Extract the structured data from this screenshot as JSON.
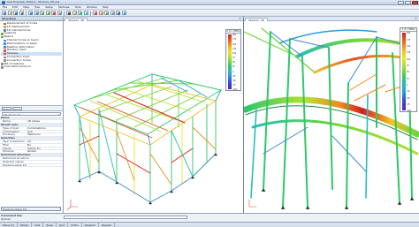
{
  "window": {
    "title": "Scia Engineer 2008.0 - Stadium_3D.esa"
  },
  "menu": [
    "File",
    "Edit",
    "View",
    "Tree",
    "Setup",
    "Modules",
    "Tools",
    "Window",
    "Help"
  ],
  "toolbar": {
    "button_icons": [
      "new-icon",
      "open-icon",
      "save-icon",
      "print-icon",
      "undo-icon",
      "redo-icon",
      "zoom-icon",
      "zoom-all-icon",
      "rotate-icon",
      "pan-icon",
      "select-icon",
      "section-icon",
      "render-icon",
      "wireframe-icon",
      "results-icon",
      "calc-icon",
      "check-icon",
      "settings-icon",
      "report-icon",
      "help-icon"
    ]
  },
  "left_panel": {
    "tree_title": "Structure",
    "tree_items": [
      {
        "label": "Displacement of nodes",
        "level": 1,
        "color": "#d04b3a"
      },
      {
        "label": "1D displacement",
        "level": 1,
        "color": "#e0a23a"
      },
      {
        "label": "1D internal forces",
        "level": 1,
        "color": "#3a8bd0"
      },
      {
        "label": "Supports",
        "level": 0,
        "color": "#6aa84f"
      },
      {
        "label": "Beams",
        "level": 0,
        "color": "#6aa84f"
      },
      {
        "label": "Internal forces on beam",
        "level": 1,
        "color": "#3a8bd0"
      },
      {
        "label": "Deformations on beam",
        "level": 1,
        "color": "#3a8bd0"
      },
      {
        "label": "Relative deformation",
        "level": 1,
        "color": "#3a8bd0"
      },
      {
        "label": "Member check",
        "level": 1,
        "color": "#d04b3a"
      },
      {
        "label": "Stresses",
        "level": 1,
        "color": "#d04b3a",
        "selected": true
      },
      {
        "label": "Connection input",
        "level": 1,
        "color": "#8a8a8a"
      },
      {
        "label": "Connection forces",
        "level": 1,
        "color": "#8a8a8a"
      },
      {
        "label": "Bill of material",
        "level": 0,
        "color": "#8a8a8a"
      },
      {
        "label": "Calculation protocol",
        "level": 0,
        "color": "#8a8a8a"
      }
    ],
    "tree_buttons": [
      "Refresh",
      "Close"
    ],
    "props_combo": "1D stress (1)",
    "props": [
      {
        "group": true,
        "label": "Name"
      },
      {
        "key": "Name",
        "value": "1D stress"
      },
      {
        "group": true,
        "label": "Result case"
      },
      {
        "key": "Type of load",
        "value": "Combinations"
      },
      {
        "key": "Combination",
        "value": "ULS"
      },
      {
        "key": "Envelope",
        "value": "Maximum"
      },
      {
        "group": true,
        "label": "Selection"
      },
      {
        "key": "Type of selection",
        "value": "All"
      },
      {
        "key": "Filter",
        "value": "No"
      },
      {
        "key": "Values",
        "value": "Sigma_E+"
      },
      {
        "key": "Extreme",
        "value": "Global"
      },
      {
        "group": true,
        "label": "Deformed structure"
      },
      {
        "key": "Deformed structure",
        "value": ""
      },
      {
        "key": "Selected values",
        "value": ""
      },
      {
        "key": "Drawing setup 1D",
        "value": ""
      }
    ],
    "action_button": "Drawing setup 1D"
  },
  "viewports": [
    {
      "tab_label": "Stadium_3D",
      "legend_title": "σ_E+ [MPa]"
    },
    {
      "tab_label": "Stadium_3D",
      "legend_title": "σ_E+ [MPa]"
    }
  ],
  "legend_values": [
    "200",
    "175",
    "150",
    "125",
    "100",
    "75",
    "50",
    "25",
    "0",
    "-25",
    "-50",
    "-75",
    "-100"
  ],
  "legend_colors": [
    "#d42020",
    "#e85020",
    "#f08a20",
    "#f5c323",
    "#e8e82a",
    "#b4e02e",
    "#6fd43a",
    "#2ec86a",
    "#24c0b8",
    "#2a9ee0",
    "#3266e0",
    "#3a3ad0",
    "#5a2ab8"
  ],
  "command_line": {
    "label": "Command line",
    "input": "",
    "history": "Refresh"
  },
  "status": {
    "cells": [
      "Plane XY",
      "Model",
      "UCS",
      "Snap",
      "Grid",
      "Ortho",
      "Stadium",
      "Results"
    ]
  }
}
